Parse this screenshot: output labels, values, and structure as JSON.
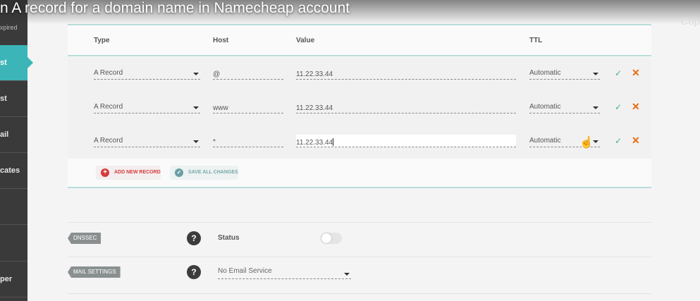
{
  "video": {
    "title": "n A record for a domain name in Namecheap account",
    "copy_label": "Cop"
  },
  "sidebar": {
    "status_text": "xpired",
    "items": [
      {
        "label": "st",
        "active": true
      },
      {
        "label": "st",
        "active": false
      },
      {
        "label": "ail",
        "active": false
      },
      {
        "label": "cates",
        "active": false
      },
      {
        "label": "",
        "active": false
      },
      {
        "label": "",
        "active": false
      },
      {
        "label": "per",
        "active": false
      }
    ]
  },
  "table": {
    "headers": {
      "type": "Type",
      "host": "Host",
      "value": "Value",
      "ttl": "TTL"
    },
    "rows": [
      {
        "type": "A Record",
        "host": "@",
        "value": "11.22.33.44",
        "ttl": "Automatic"
      },
      {
        "type": "A Record",
        "host": "www",
        "value": "11.22.33.44",
        "ttl": "Automatic"
      },
      {
        "type": "A Record",
        "host": "*",
        "value": "11.22.33.44",
        "ttl": "Automatic"
      }
    ],
    "icons": {
      "confirm": "✓",
      "delete": "✕",
      "pointer": "☝"
    }
  },
  "actions": {
    "add_new_record": "ADD NEW RECORD",
    "save_all_changes": "SAVE ALL CHANGES",
    "add_icon": "+",
    "save_icon": "✓"
  },
  "dnssec": {
    "tag": "DNSSEC",
    "help": "?",
    "status_label": "Status",
    "enabled": false
  },
  "mail_settings": {
    "tag": "MAIL SETTINGS",
    "help": "?",
    "selected": "No Email Service"
  },
  "colors": {
    "accent": "#3bb5b8",
    "confirm": "#49b27a",
    "delete": "#ea6b0d",
    "add": "#d63b3b"
  }
}
